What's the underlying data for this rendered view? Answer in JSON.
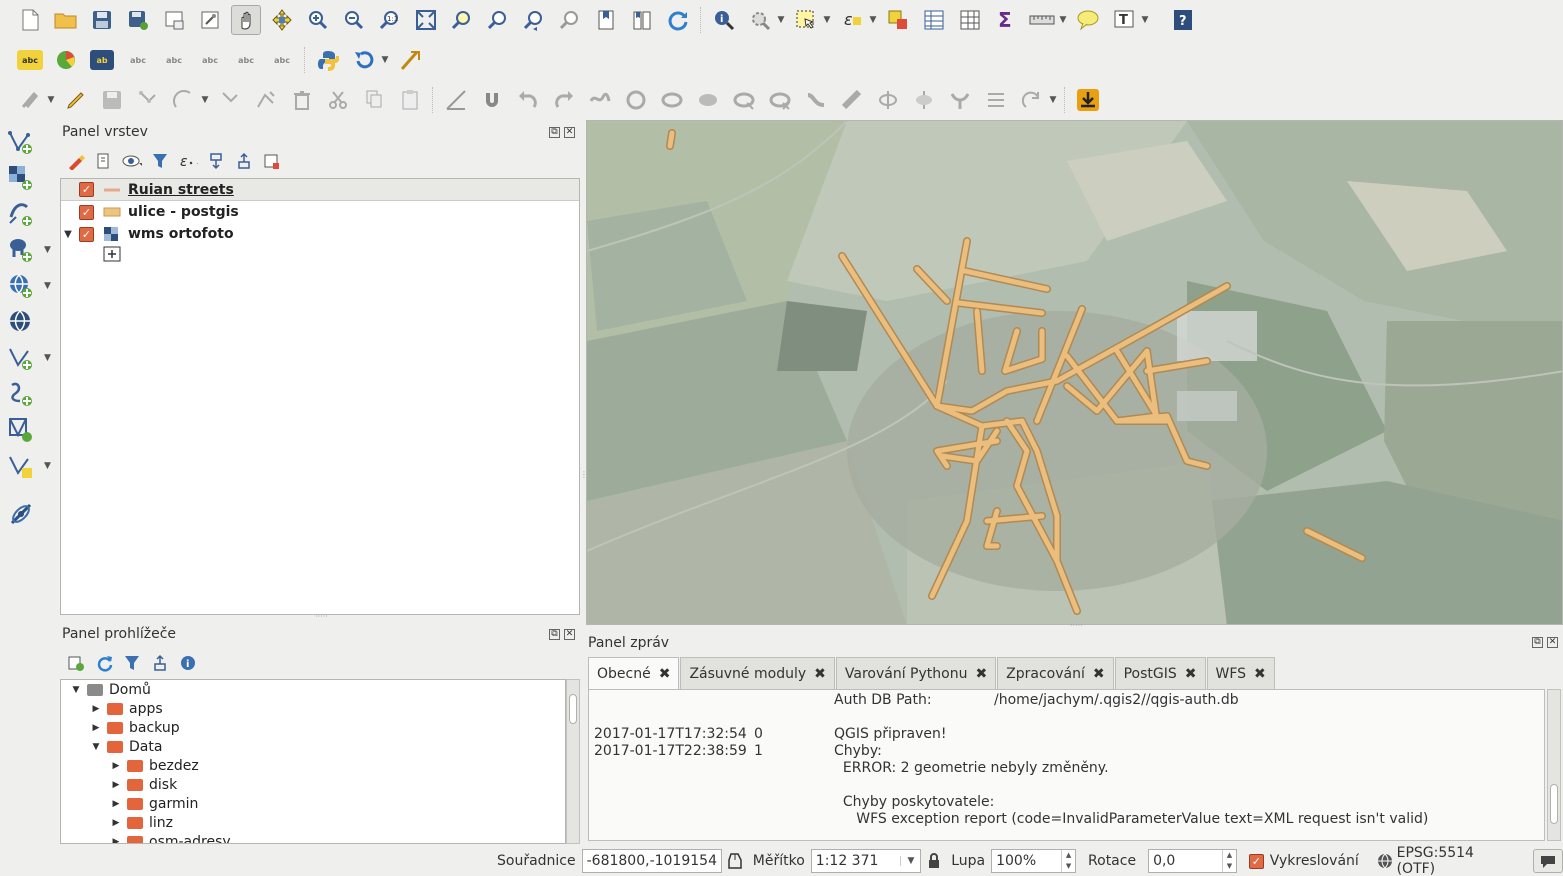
{
  "layers_panel": {
    "title": "Panel vrstev",
    "layers": [
      {
        "name": "Ruian streets",
        "checked": true,
        "symbol": "line",
        "selected": true
      },
      {
        "name": "ulice - postgis",
        "checked": true,
        "symbol": "polygon",
        "selected": false
      },
      {
        "name": "wms ortofoto",
        "checked": true,
        "symbol": "raster",
        "selected": false,
        "expanded": true
      }
    ]
  },
  "browser_panel": {
    "title": "Panel prohlížeče",
    "tree": [
      {
        "label": "Domů",
        "level": 0,
        "expanded": true,
        "type": "home"
      },
      {
        "label": "apps",
        "level": 1,
        "expanded": false,
        "type": "dir"
      },
      {
        "label": "backup",
        "level": 1,
        "expanded": false,
        "type": "dir"
      },
      {
        "label": "Data",
        "level": 1,
        "expanded": true,
        "type": "dir"
      },
      {
        "label": "bezdez",
        "level": 2,
        "expanded": false,
        "type": "dir"
      },
      {
        "label": "disk",
        "level": 2,
        "expanded": false,
        "type": "dir"
      },
      {
        "label": "garmin",
        "level": 2,
        "expanded": false,
        "type": "dir"
      },
      {
        "label": "linz",
        "level": 2,
        "expanded": false,
        "type": "dir"
      },
      {
        "label": "osm-adresy",
        "level": 2,
        "expanded": false,
        "type": "dir"
      }
    ]
  },
  "messages_panel": {
    "title": "Panel zpráv",
    "tabs": [
      "Obecné",
      "Zásuvné moduly",
      "Varování Pythonu",
      "Zpracování",
      "PostGIS",
      "WFS"
    ],
    "active_tab": "Obecné",
    "log": {
      "auth_label": "Auth DB Path:",
      "auth_path": "/home/jachym/.qgis2//qgis-auth.db",
      "entries": [
        {
          "time": "2017-01-17T17:32:54",
          "level": "0",
          "lines": [
            "QGIS připraven!"
          ]
        },
        {
          "time": "2017-01-17T22:38:59",
          "level": "1",
          "lines": [
            "Chyby:",
            "  ERROR: 2 geometrie nebyly změněny.",
            "",
            "  Chyby poskytovatele:",
            "     WFS exception report (code=InvalidParameterValue text=XML request isn't valid)"
          ]
        }
      ]
    }
  },
  "statusbar": {
    "coord_label": "Souřadnice",
    "coord_value": "-681800,-1019154",
    "scale_label": "Měřítko",
    "scale_value": "1:12 371",
    "magnifier_label": "Lupa",
    "magnifier_value": "100%",
    "rotation_label": "Rotace",
    "rotation_value": "0,0",
    "render_label": "Vykreslování",
    "render_checked": true,
    "crs": "EPSG:5514 (OTF)"
  },
  "colors": {
    "street": "#e8b46a",
    "street_outline": "#a67a3c",
    "checkbox": "#e06a43",
    "folder": "#e2653b"
  },
  "icons": {
    "toolbar1": [
      "new-project-icon",
      "open-project-icon",
      "save-project-icon",
      "save-as-icon",
      "new-print-composer-icon",
      "composer-manager-icon",
      "pan-icon",
      "pan-to-selection-icon",
      "zoom-in-icon",
      "zoom-out-icon",
      "zoom-native-icon",
      "zoom-full-icon",
      "zoom-to-selection-icon",
      "zoom-to-layer-icon",
      "zoom-last-icon",
      "zoom-next-icon",
      "new-bookmark-icon",
      "show-bookmarks-icon",
      "refresh-icon",
      "identify-icon",
      "action-icon",
      "select-icon",
      "expression-select-icon",
      "deselect-icon",
      "attribute-table-icon",
      "field-calculator-icon",
      "statistics-icon",
      "measure-icon",
      "map-tips-icon",
      "text-annotation-icon",
      "help-icon"
    ]
  }
}
